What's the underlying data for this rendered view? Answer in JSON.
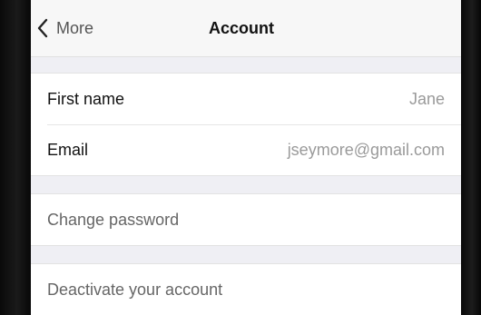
{
  "nav": {
    "back_label": "More",
    "title": "Account"
  },
  "profile": {
    "rows": [
      {
        "label": "First name",
        "value": "Jane"
      },
      {
        "label": "Email",
        "value": "jseymore@gmail.com"
      }
    ]
  },
  "actions": {
    "change_password": "Change password",
    "deactivate": "Deactivate your account"
  },
  "icons": {
    "back": "chevron-left-icon"
  }
}
